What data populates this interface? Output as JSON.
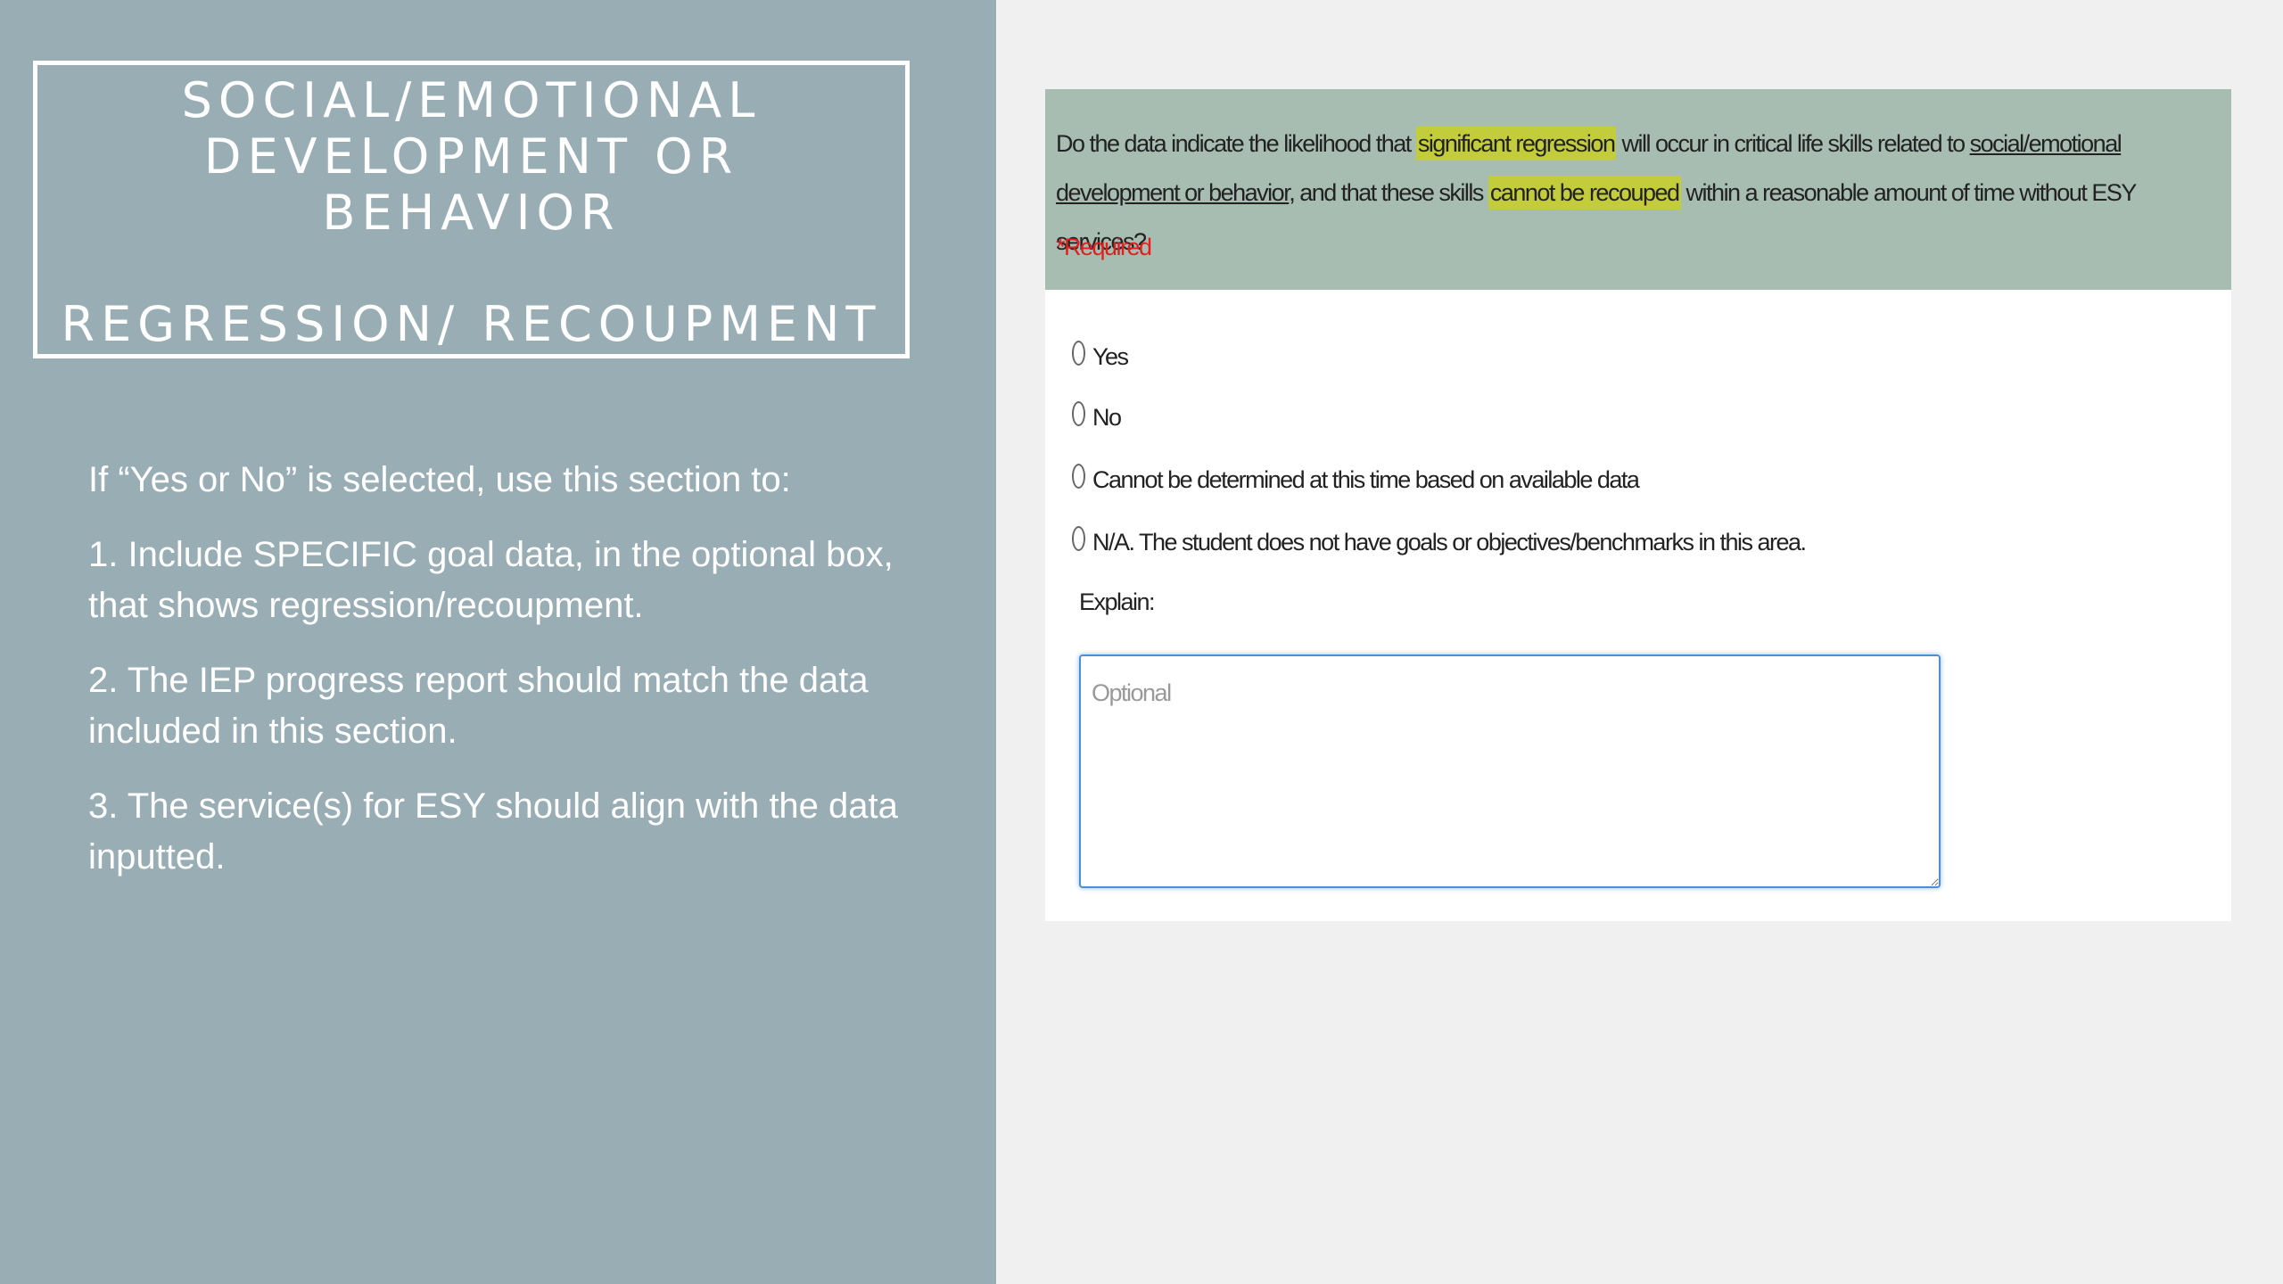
{
  "slide": {
    "title_lines": [
      "SOCIAL/EMOTIONAL",
      "DEVELOPMENT OR",
      "BEHAVIOR",
      "REGRESSION/ RECOUPMENT"
    ],
    "instructions": [
      "If “Yes or No” is selected, use this section to:",
      "1.  Include SPECIFIC goal data, in the optional box,  that shows regression/recoupment.",
      "2.  The IEP progress report should match the data included in this section.",
      "3. The service(s) for ESY should align with the data inputted."
    ],
    "colors": {
      "left_panel": "#99adb4",
      "question_header": "#a7bdb2",
      "highlight": "#c3cc3a",
      "required": "#e02020"
    }
  },
  "form": {
    "question_parts": [
      "Do the data indicate the likelihood that ",
      "significant regression",
      " will occur in critical life skills related to ",
      "social/emotional development or behavior",
      ", and that these skills ",
      "cannot be recouped",
      " within a reasonable amount of time without ESY services?"
    ],
    "required_label": "*Required",
    "options": [
      "Yes",
      "No",
      "Cannot be determined at this time based on available data",
      "N/A. The student does not have goals or objectives/benchmarks in this area."
    ],
    "explain_label": "Explain:",
    "explain_placeholder": "Optional"
  }
}
